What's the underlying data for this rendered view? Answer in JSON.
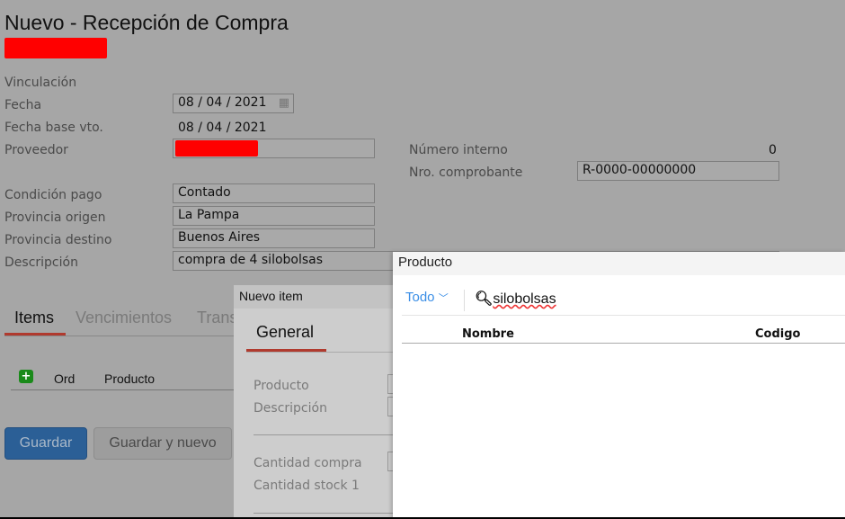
{
  "header": {
    "title": "Nuevo - Recepción de Compra"
  },
  "form": {
    "vinculacion_label": "Vinculación",
    "fecha_label": "Fecha",
    "fecha_value": "08 / 04 / 2021",
    "fecha_base_label": "Fecha base vto.",
    "fecha_base_value": "08 / 04 / 2021",
    "proveedor_label": "Proveedor",
    "numero_interno_label": "Número interno",
    "numero_interno_value": "0",
    "nro_comprobante_label": "Nro. comprobante",
    "nro_comprobante_value": "R-0000-00000000",
    "condicion_label": "Condición pago",
    "condicion_value": "Contado",
    "prov_origen_label": "Provincia origen",
    "prov_origen_value": "La Pampa",
    "prov_destino_label": "Provincia destino",
    "prov_destino_value": "Buenos Aires",
    "descripcion_label": "Descripción",
    "descripcion_value": "compra de 4 silobolsas"
  },
  "tabs": [
    "Items",
    "Vencimientos",
    "Trans"
  ],
  "items_table": {
    "headers": [
      "Ord",
      "Producto"
    ]
  },
  "buttons": {
    "save": "Guardar",
    "save_new": "Guardar y nuevo"
  },
  "nuevo_item": {
    "title": "Nuevo item",
    "tab": "General",
    "producto": "Producto",
    "descripcion": "Descripción",
    "cantidad_compra": "Cantidad compra",
    "cantidad_stock": "Cantidad stock 1"
  },
  "producto_dialog": {
    "title": "Producto",
    "filter": "Todo",
    "search_value": "silobolsas",
    "columns": [
      "Nombre",
      "Codigo"
    ]
  }
}
